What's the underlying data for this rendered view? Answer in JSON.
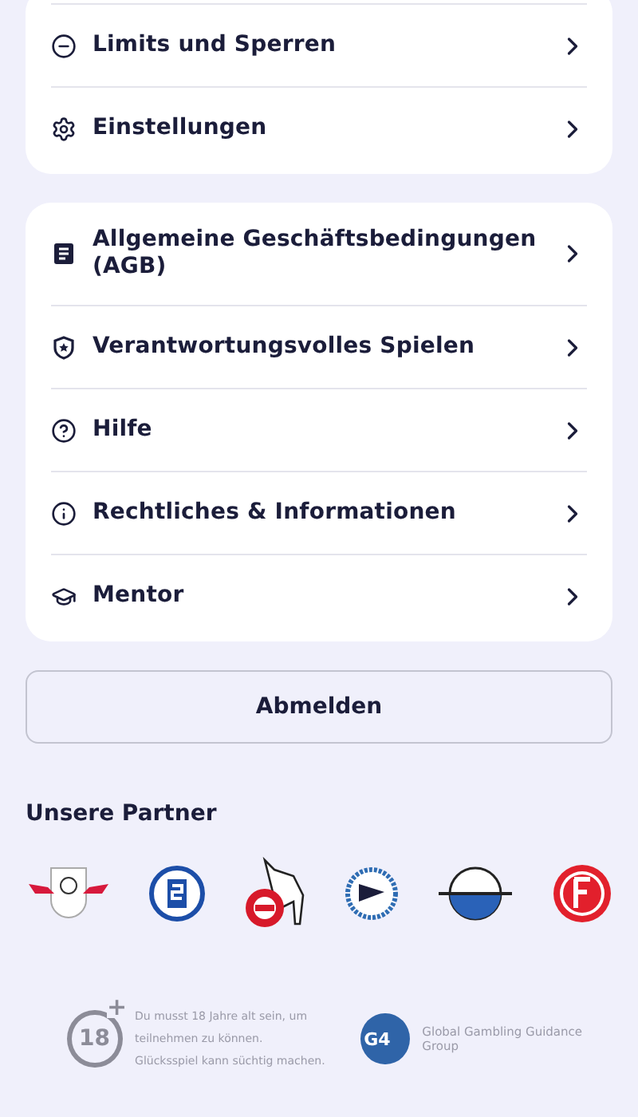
{
  "menu_groups": [
    {
      "items": [
        {
          "kind": "minus-circle",
          "label": "Limits und Sperren"
        },
        {
          "kind": "gear",
          "label": "Einstellungen"
        }
      ]
    },
    {
      "items": [
        {
          "kind": "document",
          "label": "Allgemeine Geschäftsbedingungen (AGB)"
        },
        {
          "kind": "shield-star",
          "label": "Verantwortungsvolles Spielen"
        },
        {
          "kind": "question",
          "label": "Hilfe"
        },
        {
          "kind": "info",
          "label": "Rechtliches & Informationen"
        },
        {
          "kind": "graduation-cap",
          "label": "Mentor"
        }
      ]
    }
  ],
  "logout_button": "Abmelden",
  "partners": {
    "title": "Unsere Partner",
    "logos": [
      {
        "kind": "bulls",
        "color": "#d7193c"
      },
      {
        "kind": "round-s",
        "color": "#1c4ea8"
      },
      {
        "kind": "goat",
        "color": "#d7192a"
      },
      {
        "kind": "eagle",
        "color": "#2f6db3"
      },
      {
        "kind": "half-disc",
        "color": "#2a62b8"
      },
      {
        "kind": "ring-red",
        "color": "#e2202c"
      }
    ]
  },
  "footer": {
    "age_badge": "18",
    "age_plus": "+",
    "age_notice": [
      "Du musst 18 Jahre alt sein, um",
      "teilnehmen zu können.",
      "Glücksspiel kann süchtig machen."
    ],
    "g4_logo": "G4",
    "g4_name": "Global Gambling Guidance Group"
  }
}
